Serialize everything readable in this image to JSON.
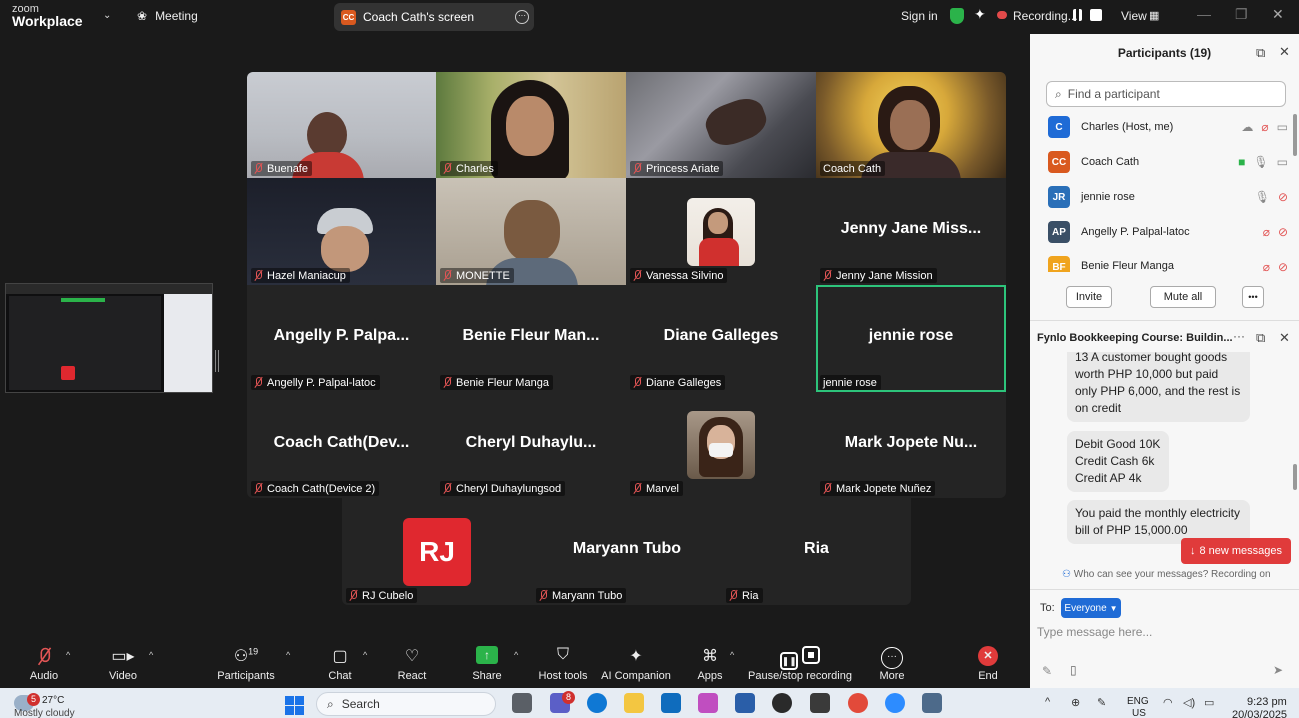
{
  "topbar": {
    "logo_top": "zoom",
    "logo_bottom": "Workplace",
    "meeting_label": "Meeting",
    "share_badge": "CC",
    "share_label": "Coach Cath's screen",
    "sign_in": "Sign in",
    "recording": "Recording...",
    "view": "View"
  },
  "gallery": {
    "tiles": [
      {
        "name": "Buenafe",
        "kind": "video"
      },
      {
        "name": "Charles",
        "kind": "video"
      },
      {
        "name": "Princess Ariate",
        "kind": "video"
      },
      {
        "name": "Coach Cath",
        "kind": "video"
      },
      {
        "name": "Hazel Maniacup",
        "kind": "video"
      },
      {
        "name": "MONETTE",
        "kind": "video"
      },
      {
        "name": "Vanessa Silvino",
        "kind": "avatar"
      },
      {
        "name": "Jenny Jane Mission",
        "display": "Jenny Jane Miss...",
        "kind": "text"
      },
      {
        "name": "Angelly P. Palpal-latoc",
        "display": "Angelly P. Palpa...",
        "kind": "text"
      },
      {
        "name": "Benie Fleur Manga",
        "display": "Benie Fleur Man...",
        "kind": "text"
      },
      {
        "name": "Diane Galleges",
        "display": "Diane Galleges",
        "kind": "text"
      },
      {
        "name": "jennie rose",
        "display": "jennie rose",
        "kind": "text",
        "active": true
      },
      {
        "name": "Coach Cath(Device 2)",
        "display": "Coach Cath(Dev...",
        "kind": "text"
      },
      {
        "name": "Cheryl Duhaylungsod",
        "display": "Cheryl Duhaylu...",
        "kind": "text"
      },
      {
        "name": "Marvel",
        "kind": "avatar"
      },
      {
        "name": "Mark Jopete Nuñez",
        "display": "Mark Jopete Nu...",
        "kind": "text"
      },
      {
        "name": "RJ Cubelo",
        "initials": "RJ",
        "kind": "initials"
      },
      {
        "name": "Maryann Tubo",
        "display": "Maryann Tubo",
        "kind": "text"
      },
      {
        "name": "Ria",
        "display": "Ria",
        "kind": "text"
      }
    ]
  },
  "participants_panel": {
    "title": "Participants (19)",
    "search_placeholder": "Find a participant",
    "rows": [
      {
        "initials": "C",
        "name": "Charles (Host, me)",
        "color": "#1f6bd6"
      },
      {
        "initials": "CC",
        "name": "Coach Cath",
        "color": "#d9591f"
      },
      {
        "initials": "JR",
        "name": "jennie rose",
        "color": "#2a6fb8"
      },
      {
        "initials": "AP",
        "name": "Angelly P. Palpal-latoc",
        "color": "#3a4f66"
      },
      {
        "initials": "BF",
        "name": "Benie Fleur Manga",
        "color": "#f0a41e"
      }
    ],
    "invite": "Invite",
    "mute_all": "Mute all",
    "more": "•••"
  },
  "chat_panel": {
    "title": "Fynlo Bookkeeping Course: Buildin...",
    "messages": [
      "13  A customer bought goods worth PHP 10,000 but paid only PHP 6,000, and the rest is on credit",
      "Debit Good 10K\nCredit Cash 6k\nCredit AP 4k",
      "You paid the monthly electricity bill of PHP 15,000.00"
    ],
    "new_messages": "8 new messages",
    "who_can_see": "Who can see your messages? Recording on",
    "to_label": "To:",
    "to_value": "Everyone",
    "input_placeholder": "Type message here..."
  },
  "toolbar": {
    "audio": "Audio",
    "video": "Video",
    "participants": "Participants",
    "participants_count": "19",
    "chat": "Chat",
    "react": "React",
    "share": "Share",
    "host_tools": "Host tools",
    "ai_companion": "AI Companion",
    "apps": "Apps",
    "pause_stop": "Pause/stop recording",
    "more": "More",
    "end": "End"
  },
  "taskbar": {
    "weather_temp": "27°C",
    "weather_desc": "Mostly cloudy",
    "weather_badge": "5",
    "search": "Search",
    "teams_badge": "8",
    "lang_top": "ENG",
    "lang_bottom": "US",
    "time": "9:23 pm",
    "date": "20/03/2025"
  },
  "colors": {
    "active_speaker": "#2dc47b",
    "record_red": "#e24a4a",
    "share_green": "#2bb34a",
    "end_red": "#e03b3b"
  }
}
